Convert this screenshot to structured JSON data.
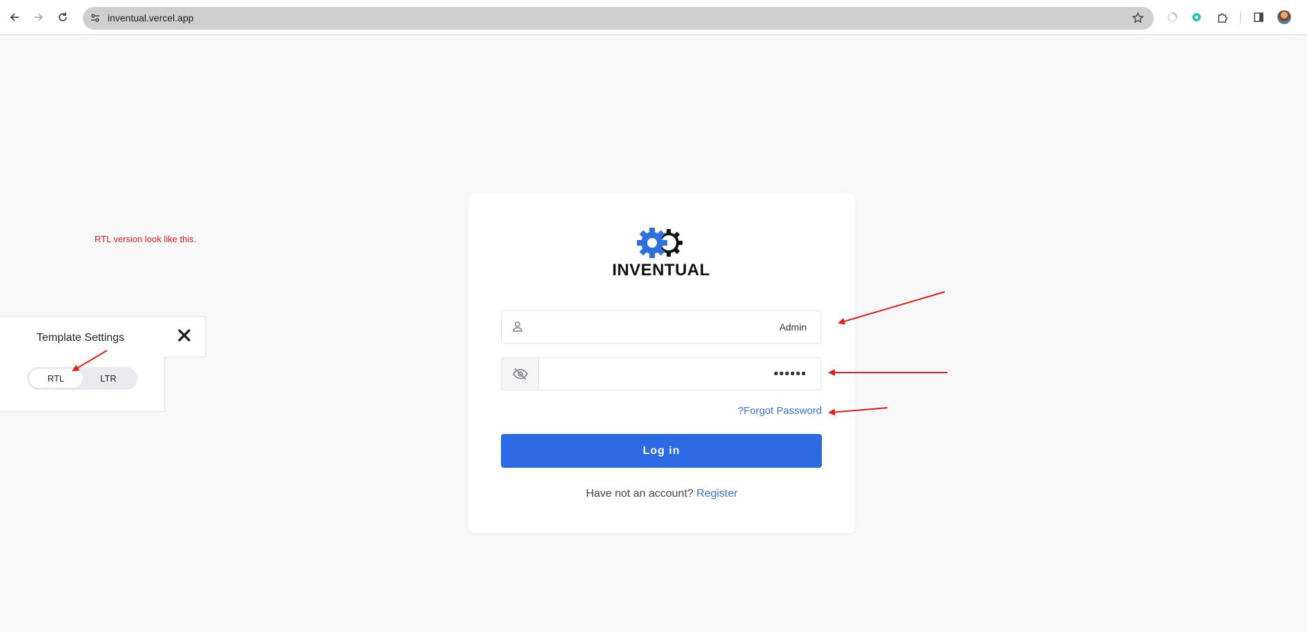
{
  "browser": {
    "url": "inventual.vercel.app",
    "icons": [
      "back-icon",
      "forward-icon",
      "reload-icon",
      "site-settings-icon",
      "bookmark-star-icon",
      "extension-icon",
      "puzzle-icon",
      "sidepanel-icon",
      "profile-avatar"
    ]
  },
  "annotation": {
    "note": "RTL version look like this.",
    "arrow_color": "#e21b1b"
  },
  "template_settings": {
    "title": "Template Settings",
    "options": [
      "RTL",
      "LTR"
    ],
    "selected": "RTL"
  },
  "login": {
    "brand": "INVENTUAL",
    "brand_colors": {
      "gear_primary": "#2f6fe0",
      "gear_outline": "#111111"
    },
    "username_value": "Admin",
    "password_value": "••••••",
    "forgot_link": "?Forgot Password",
    "login_button": "Log in",
    "register_prompt": "Have not an account?",
    "register_link": "Register",
    "accent": "#2c6ae3"
  }
}
